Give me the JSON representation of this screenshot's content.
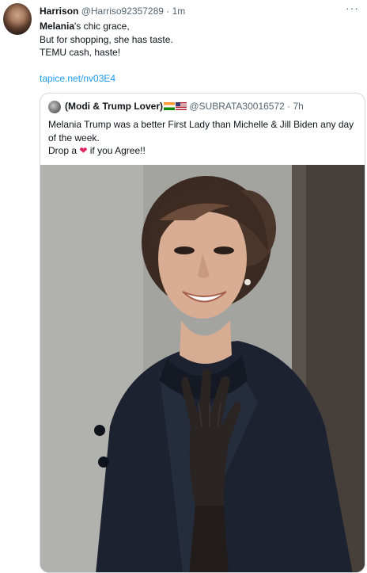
{
  "tweet": {
    "author_name": "Harrison",
    "author_handle": "@Harriso92357289",
    "separator": " · ",
    "timestamp": "1m",
    "more_icon": "more-icon",
    "lines": {
      "line1_bold": "Melania",
      "line1_rest": "'s chic grace,",
      "line2": "But for shopping, she has taste.",
      "line3": "TEMU cash, haste!"
    },
    "link": "tapice.net/nv03E4"
  },
  "quote": {
    "author_name": "(Modi & Trump Lover)",
    "flags": [
      "flag-india-icon",
      "flag-usa-icon"
    ],
    "author_handle": "@SUBRATA30016572",
    "separator": " · ",
    "timestamp": "7h",
    "text_line1": "Melania Trump was a better First Lady than Michelle & Jill Biden any day of the week.",
    "text_line2_pre": "Drop a ",
    "heart_glyph": "❤",
    "text_line2_post": " if you Agree!!",
    "photo_icon": "photo-of-smiling-woman-waving"
  },
  "colors": {
    "text": "#0f1419",
    "muted": "#536471",
    "link": "#1d9bf0",
    "border": "#cfd9de",
    "heart": "#e0245e"
  }
}
